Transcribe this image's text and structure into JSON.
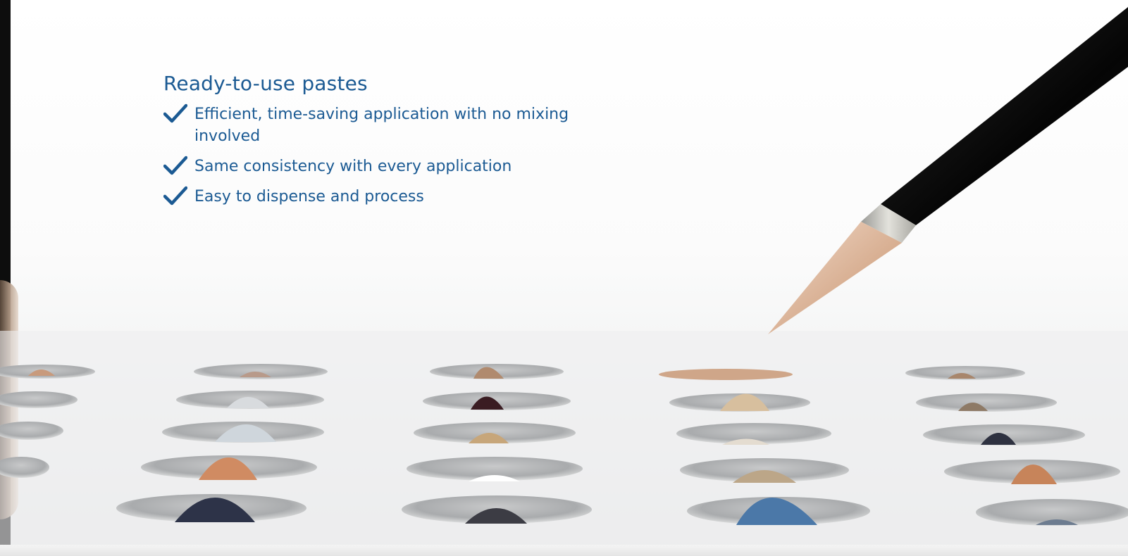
{
  "headline": "Ready-to-use pastes",
  "benefits": [
    {
      "text": "Efficient, time-saving application with no mixing involved"
    },
    {
      "text": "Same consistency with every application"
    },
    {
      "text": "Easy to dispense and process"
    }
  ],
  "icons": {
    "bullet": "checkmark-icon"
  },
  "colors": {
    "text": "#1b5a93",
    "checkmark": "#1b5a93",
    "background": "#ffffff"
  }
}
